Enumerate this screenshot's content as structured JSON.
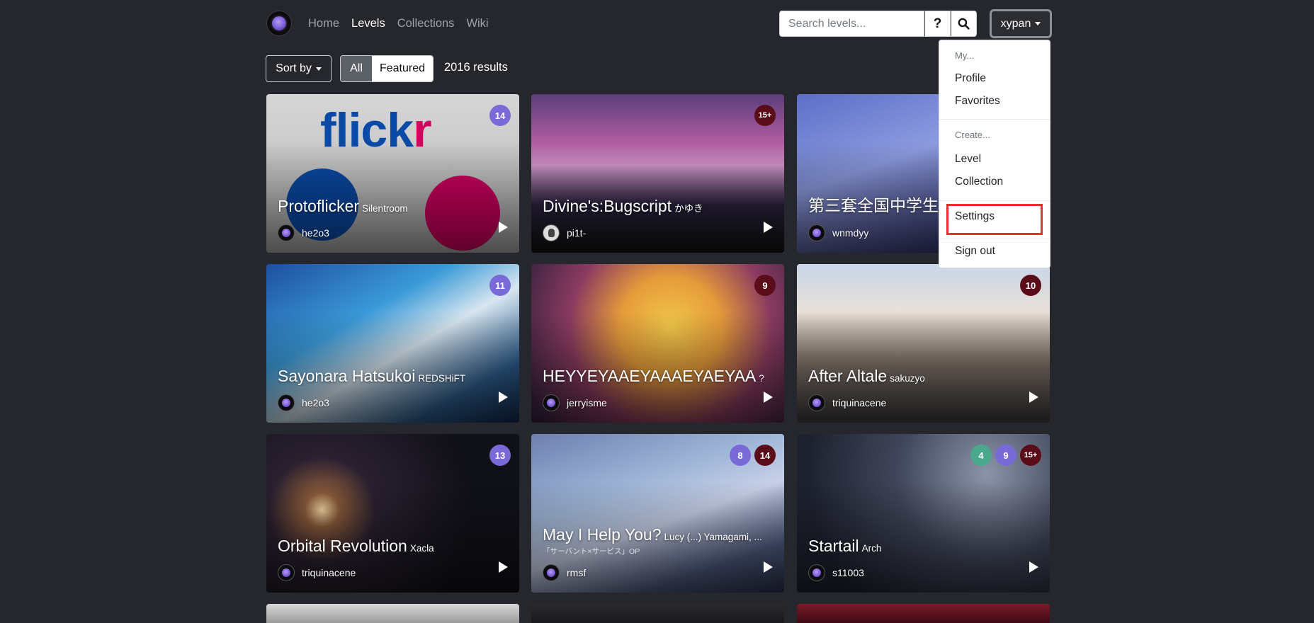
{
  "nav": {
    "links": [
      {
        "label": "Home",
        "active": false
      },
      {
        "label": "Levels",
        "active": true
      },
      {
        "label": "Collections",
        "active": false
      },
      {
        "label": "Wiki",
        "active": false
      }
    ]
  },
  "search": {
    "placeholder": "Search levels...",
    "help_label": "?",
    "search_icon": "search-icon"
  },
  "user_menu": {
    "username": "xypan",
    "header_my": "My...",
    "profile": "Profile",
    "favorites": "Favorites",
    "header_create": "Create...",
    "level": "Level",
    "collection": "Collection",
    "settings": "Settings",
    "sign_out": "Sign out"
  },
  "filters": {
    "sort_by": "Sort by",
    "all": "All",
    "featured": "Featured",
    "results": "2016 results"
  },
  "cards": [
    {
      "title": "Protoflicker",
      "artist": "Silentroom",
      "owner": "he2o3",
      "badges": [
        "14"
      ]
    },
    {
      "title": "Divine's:Bugscript",
      "artist": "かゆき",
      "owner": "pi1t-",
      "badges": [
        "15+"
      ]
    },
    {
      "title": "第三套全国中学生",
      "artist": "",
      "owner": "wnmdyy",
      "badges": []
    },
    {
      "title": "Sayonara Hatsukoi",
      "artist": "REDSHiFT",
      "owner": "he2o3",
      "badges": [
        "11"
      ]
    },
    {
      "title": "HEYYEYAAEYAAAEYAEYAA",
      "artist": "?",
      "owner": "jerryisme",
      "badges": [
        "9"
      ]
    },
    {
      "title": "After Altale",
      "artist": "sakuzyo",
      "owner": "triquinacene",
      "badges": [
        "10"
      ]
    },
    {
      "title": "Orbital Revolution",
      "artist": "Xacla",
      "owner": "triquinacene",
      "badges": [
        "13"
      ]
    },
    {
      "title": "May I Help You?",
      "artist": "Lucy (...) Yamagami, ...",
      "subtitle": "「サーバント×サービス」OP",
      "owner": "rmsf",
      "badges": [
        "8",
        "14"
      ]
    },
    {
      "title": "Startail",
      "artist": "Arch",
      "owner": "s11003",
      "badges": [
        "4",
        "9",
        "15+"
      ]
    }
  ]
}
